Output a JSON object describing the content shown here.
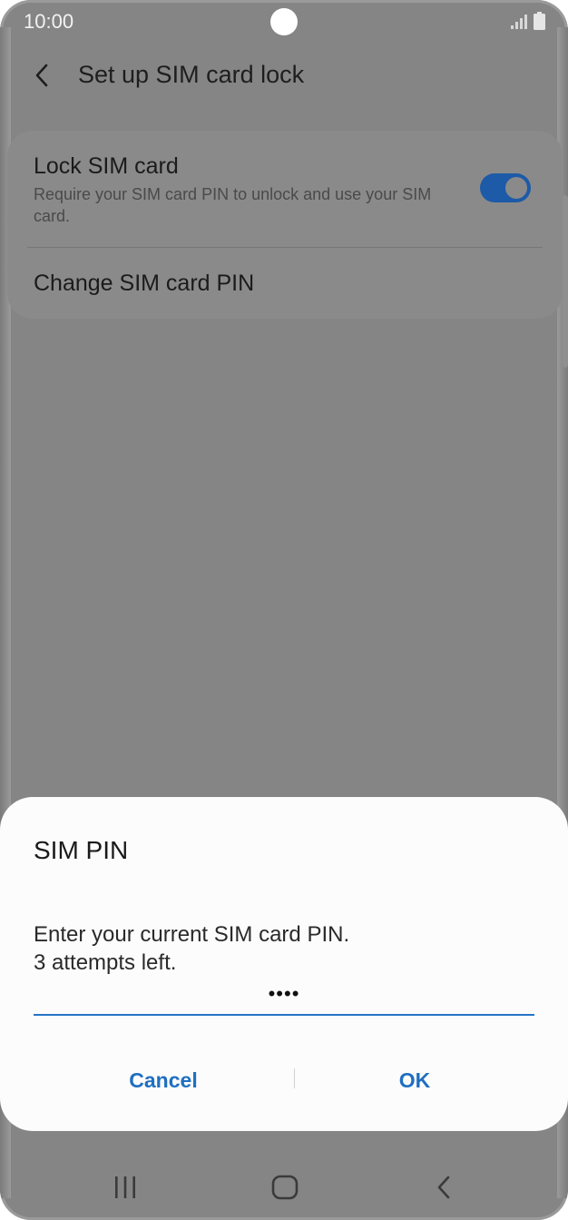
{
  "status_bar": {
    "time": "10:00"
  },
  "header": {
    "title": "Set up SIM card lock"
  },
  "settings": {
    "lock_sim": {
      "title": "Lock SIM card",
      "description": "Require your SIM card PIN to unlock and use your SIM card.",
      "enabled": true
    },
    "change_pin": {
      "title": "Change SIM card PIN"
    }
  },
  "dialog": {
    "title": "SIM PIN",
    "message_line1": "Enter your current SIM card PIN.",
    "message_line2": "3 attempts left.",
    "pin_value": "••••",
    "cancel_label": "Cancel",
    "ok_label": "OK"
  },
  "colors": {
    "accent": "#1f6fc0",
    "toggle_on": "#1d5aa8",
    "scrim": "#858585",
    "dialog_bg": "#fcfcfc"
  },
  "icons": {
    "back": "chevron-left-icon",
    "signal": "signal-icon",
    "battery": "battery-icon",
    "nav_recents": "recents-icon",
    "nav_home": "home-icon",
    "nav_back": "back-icon"
  }
}
